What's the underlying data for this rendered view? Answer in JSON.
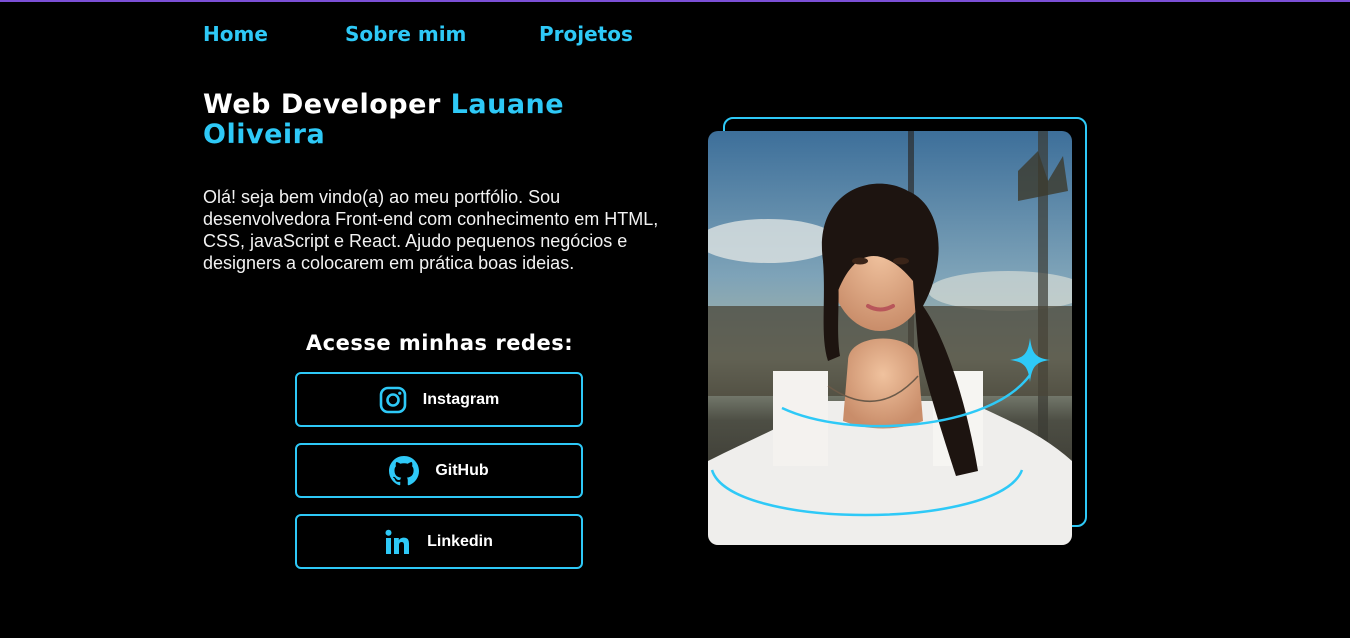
{
  "nav": {
    "items": [
      {
        "label": "Home"
      },
      {
        "label": "Sobre mim"
      },
      {
        "label": "Projetos"
      }
    ]
  },
  "hero": {
    "title_prefix": "Web Developer",
    "title_name": "Lauane Oliveira",
    "intro": "Olá! seja bem vindo(a) ao meu portfólio. Sou desenvolvedora Front-end com conhecimento em HTML, CSS, javaScript e React. Ajudo pequenos negócios e designers a colocarem em prática boas ideias."
  },
  "socials": {
    "title": "Acesse minhas redes:",
    "buttons": [
      {
        "label": "Instagram",
        "icon": "instagram-icon"
      },
      {
        "label": "GitHub",
        "icon": "github-icon"
      },
      {
        "label": "Linkedin",
        "icon": "linkedin-icon"
      }
    ]
  },
  "colors": {
    "accent": "#2ec9f7",
    "background": "#000000",
    "top_border": "#7b4fd6",
    "text": "#ffffff"
  }
}
